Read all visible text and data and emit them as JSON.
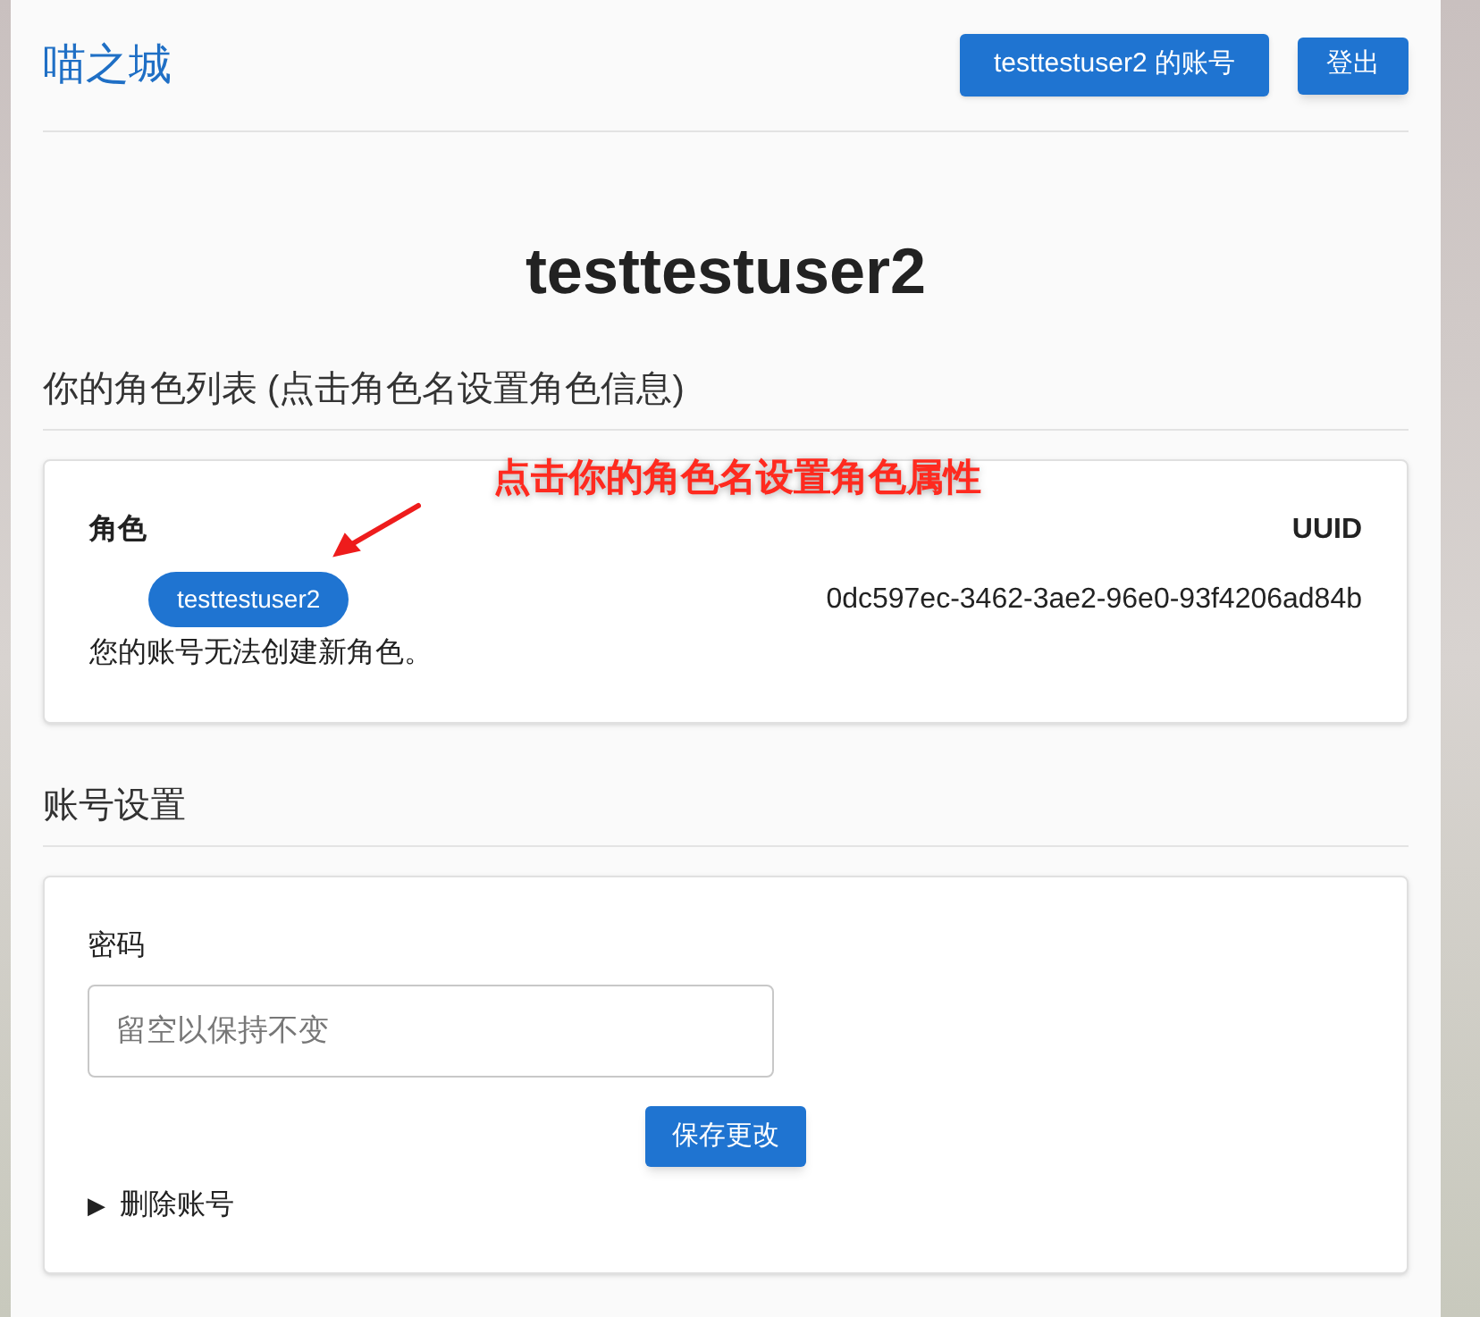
{
  "header": {
    "site_title": "喵之城",
    "buttons": [
      {
        "label": "testtestuser2 的账号"
      },
      {
        "label": "登出"
      }
    ]
  },
  "page_title": "testtestuser2",
  "characters_section": {
    "heading": "你的角色列表 (点击角色名设置角色信息)",
    "columns": [
      "角色",
      "UUID"
    ],
    "rows": [
      {
        "name": "testtestuser2",
        "uuid": "0dc597ec-3462-3ae2-96e0-93f4206ad84b"
      }
    ],
    "note": "您的账号无法创建新角色。"
  },
  "annotation": {
    "text": "点击你的角色名设置角色属性"
  },
  "account_section": {
    "heading": "账号设置",
    "password": {
      "label": "密码",
      "placeholder": "留空以保持不变"
    },
    "save_button": "保存更改",
    "delete_account": {
      "marker": "▶",
      "label": "删除账号"
    }
  }
}
